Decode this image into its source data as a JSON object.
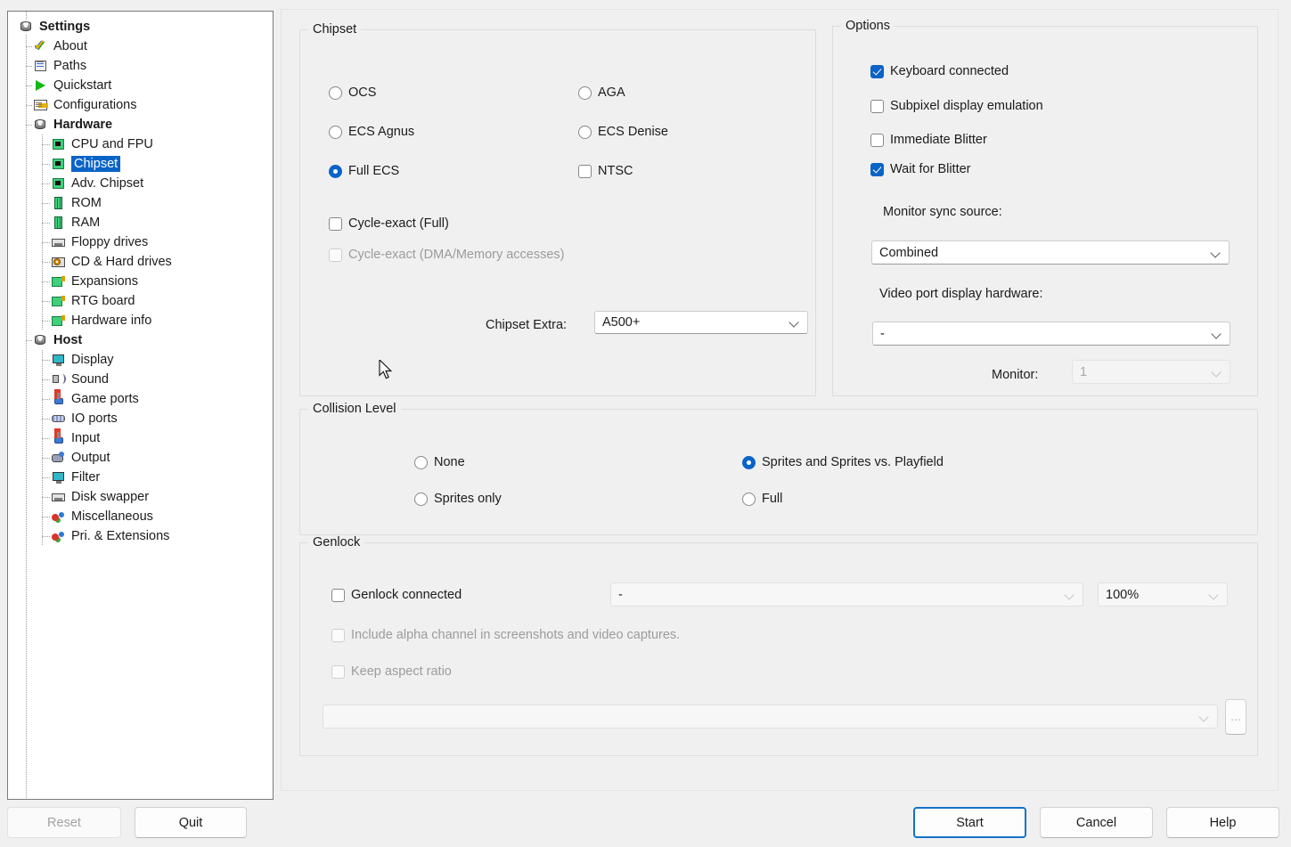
{
  "sidebar": {
    "title": "Settings",
    "items": [
      {
        "label": "Settings",
        "level": 0,
        "icon": "stack-icon",
        "bold": true,
        "selected": false
      },
      {
        "label": "About",
        "level": 1,
        "icon": "check-icon",
        "bold": false,
        "selected": false
      },
      {
        "label": "Paths",
        "level": 1,
        "icon": "paths-icon",
        "bold": false,
        "selected": false
      },
      {
        "label": "Quickstart",
        "level": 1,
        "icon": "play-icon",
        "bold": false,
        "selected": false
      },
      {
        "label": "Configurations",
        "level": 1,
        "icon": "config-icon",
        "bold": false,
        "selected": false
      },
      {
        "label": "Hardware",
        "level": 1,
        "icon": "stack-icon",
        "bold": true,
        "selected": false
      },
      {
        "label": "CPU and FPU",
        "level": 2,
        "icon": "chip-icon",
        "bold": false,
        "selected": false
      },
      {
        "label": "Chipset",
        "level": 2,
        "icon": "chip-icon",
        "bold": false,
        "selected": true
      },
      {
        "label": "Adv. Chipset",
        "level": 2,
        "icon": "chip-icon",
        "bold": false,
        "selected": false
      },
      {
        "label": "ROM",
        "level": 2,
        "icon": "ram-icon",
        "bold": false,
        "selected": false
      },
      {
        "label": "RAM",
        "level": 2,
        "icon": "ram-icon",
        "bold": false,
        "selected": false
      },
      {
        "label": "Floppy drives",
        "level": 2,
        "icon": "floppy-icon",
        "bold": false,
        "selected": false
      },
      {
        "label": "CD & Hard drives",
        "level": 2,
        "icon": "cd-icon",
        "bold": false,
        "selected": false
      },
      {
        "label": "Expansions",
        "level": 2,
        "icon": "board-icon",
        "bold": false,
        "selected": false
      },
      {
        "label": "RTG board",
        "level": 2,
        "icon": "board-icon",
        "bold": false,
        "selected": false
      },
      {
        "label": "Hardware info",
        "level": 2,
        "icon": "board-icon",
        "bold": false,
        "selected": false
      },
      {
        "label": "Host",
        "level": 1,
        "icon": "stack-icon",
        "bold": true,
        "selected": false
      },
      {
        "label": "Display",
        "level": 2,
        "icon": "monitor-icon",
        "bold": false,
        "selected": false
      },
      {
        "label": "Sound",
        "level": 2,
        "icon": "sound-icon",
        "bold": false,
        "selected": false
      },
      {
        "label": "Game ports",
        "level": 2,
        "icon": "joystick-icon",
        "bold": false,
        "selected": false
      },
      {
        "label": "IO ports",
        "level": 2,
        "icon": "ioports-icon",
        "bold": false,
        "selected": false
      },
      {
        "label": "Input",
        "level": 2,
        "icon": "joystick-icon",
        "bold": false,
        "selected": false
      },
      {
        "label": "Output",
        "level": 2,
        "icon": "output-icon",
        "bold": false,
        "selected": false
      },
      {
        "label": "Filter",
        "level": 2,
        "icon": "monitor-icon",
        "bold": false,
        "selected": false
      },
      {
        "label": "Disk swapper",
        "level": 2,
        "icon": "floppy-icon",
        "bold": false,
        "selected": false
      },
      {
        "label": "Miscellaneous",
        "level": 2,
        "icon": "misc-icon",
        "bold": false,
        "selected": false
      },
      {
        "label": "Pri. & Extensions",
        "level": 2,
        "icon": "misc-icon",
        "bold": false,
        "selected": false
      }
    ]
  },
  "chipset": {
    "legend": "Chipset",
    "radios": [
      {
        "label": "OCS",
        "checked": false
      },
      {
        "label": "ECS Agnus",
        "checked": false
      },
      {
        "label": "Full ECS",
        "checked": true
      },
      {
        "label": "AGA",
        "checked": false
      },
      {
        "label": "ECS Denise",
        "checked": false
      }
    ],
    "ntsc": {
      "label": "NTSC",
      "checked": false
    },
    "cycle_exact_full": {
      "label": "Cycle-exact (Full)",
      "checked": false,
      "disabled": false
    },
    "cycle_exact_dma": {
      "label": "Cycle-exact (DMA/Memory accesses)",
      "checked": false,
      "disabled": true
    },
    "extra_label": "Chipset Extra:",
    "extra_value": "A500+"
  },
  "options": {
    "legend": "Options",
    "checkboxes": [
      {
        "label": "Keyboard connected",
        "checked": true
      },
      {
        "label": "Subpixel display emulation",
        "checked": false
      },
      {
        "label": "Immediate Blitter",
        "checked": false
      },
      {
        "label": "Wait for Blitter",
        "checked": true
      }
    ],
    "monitor_sync_label": "Monitor sync source:",
    "monitor_sync_value": "Combined",
    "video_port_label": "Video port display hardware:",
    "video_port_value": "-",
    "monitor_label": "Monitor:",
    "monitor_value": "1",
    "monitor_disabled": true
  },
  "collision": {
    "legend": "Collision Level",
    "options": [
      {
        "label": "None",
        "checked": false
      },
      {
        "label": "Sprites only",
        "checked": false
      },
      {
        "label": "Sprites and Sprites vs. Playfield",
        "checked": true
      },
      {
        "label": "Full",
        "checked": false
      }
    ]
  },
  "genlock": {
    "legend": "Genlock",
    "connected": {
      "label": "Genlock connected",
      "checked": false,
      "disabled": false
    },
    "device_value": "-",
    "mix_value": "100%",
    "alpha": {
      "label": "Include alpha channel in screenshots and video captures.",
      "checked": false,
      "disabled": true
    },
    "aspect": {
      "label": "Keep aspect ratio",
      "checked": false,
      "disabled": true
    },
    "file_value": "",
    "browse_label": "..."
  },
  "buttons": {
    "reset": {
      "label": "Reset",
      "disabled": true,
      "default": false
    },
    "quit": {
      "label": "Quit",
      "disabled": false,
      "default": false
    },
    "start": {
      "label": "Start",
      "disabled": false,
      "default": true
    },
    "cancel": {
      "label": "Cancel",
      "disabled": false,
      "default": false
    },
    "help": {
      "label": "Help",
      "disabled": false,
      "default": false
    }
  },
  "colors": {
    "accent": "#0a64c8",
    "selection": "#0a64c8",
    "window_bg": "#f0f0f0",
    "panel_bg": "#ffffff",
    "group_border": "#dcdcdc",
    "text": "#1b1b1b",
    "text_disabled": "#9c9c9c"
  }
}
